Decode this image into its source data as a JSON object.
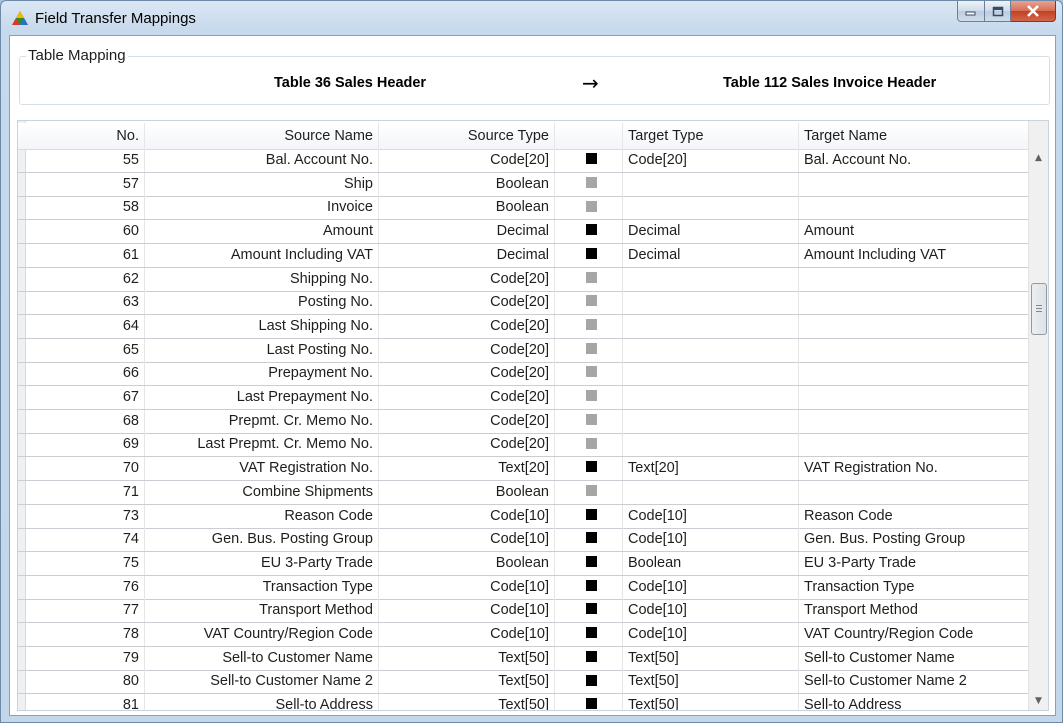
{
  "window": {
    "title": "Field Transfer Mappings",
    "buttons": {
      "minimize": "minimize",
      "maximize": "maximize",
      "close": "close"
    }
  },
  "mapping": {
    "group_label": "Table Mapping",
    "source_table": "Table 36 Sales Header",
    "arrow": "→",
    "target_table": "Table 112 Sales Invoice Header"
  },
  "grid": {
    "columns": {
      "no": "No.",
      "source_name": "Source Name",
      "source_type": "Source Type",
      "mapped": "",
      "target_type": "Target Type",
      "target_name": "Target Name"
    },
    "rows": [
      {
        "no": "55",
        "source_name": "Bal. Account No.",
        "source_type": "Code[20]",
        "mapped": true,
        "target_type": "Code[20]",
        "target_name": "Bal. Account No."
      },
      {
        "no": "57",
        "source_name": "Ship",
        "source_type": "Boolean",
        "mapped": false,
        "target_type": "",
        "target_name": ""
      },
      {
        "no": "58",
        "source_name": "Invoice",
        "source_type": "Boolean",
        "mapped": false,
        "target_type": "",
        "target_name": ""
      },
      {
        "no": "60",
        "source_name": "Amount",
        "source_type": "Decimal",
        "mapped": true,
        "target_type": "Decimal",
        "target_name": "Amount"
      },
      {
        "no": "61",
        "source_name": "Amount Including VAT",
        "source_type": "Decimal",
        "mapped": true,
        "target_type": "Decimal",
        "target_name": "Amount Including VAT"
      },
      {
        "no": "62",
        "source_name": "Shipping No.",
        "source_type": "Code[20]",
        "mapped": false,
        "target_type": "",
        "target_name": ""
      },
      {
        "no": "63",
        "source_name": "Posting No.",
        "source_type": "Code[20]",
        "mapped": false,
        "target_type": "",
        "target_name": ""
      },
      {
        "no": "64",
        "source_name": "Last Shipping No.",
        "source_type": "Code[20]",
        "mapped": false,
        "target_type": "",
        "target_name": ""
      },
      {
        "no": "65",
        "source_name": "Last Posting No.",
        "source_type": "Code[20]",
        "mapped": false,
        "target_type": "",
        "target_name": ""
      },
      {
        "no": "66",
        "source_name": "Prepayment No.",
        "source_type": "Code[20]",
        "mapped": false,
        "target_type": "",
        "target_name": ""
      },
      {
        "no": "67",
        "source_name": "Last Prepayment No.",
        "source_type": "Code[20]",
        "mapped": false,
        "target_type": "",
        "target_name": ""
      },
      {
        "no": "68",
        "source_name": "Prepmt. Cr. Memo No.",
        "source_type": "Code[20]",
        "mapped": false,
        "target_type": "",
        "target_name": ""
      },
      {
        "no": "69",
        "source_name": "Last Prepmt. Cr. Memo No.",
        "source_type": "Code[20]",
        "mapped": false,
        "target_type": "",
        "target_name": ""
      },
      {
        "no": "70",
        "source_name": "VAT Registration No.",
        "source_type": "Text[20]",
        "mapped": true,
        "target_type": "Text[20]",
        "target_name": "VAT Registration No."
      },
      {
        "no": "71",
        "source_name": "Combine Shipments",
        "source_type": "Boolean",
        "mapped": false,
        "target_type": "",
        "target_name": ""
      },
      {
        "no": "73",
        "source_name": "Reason Code",
        "source_type": "Code[10]",
        "mapped": true,
        "target_type": "Code[10]",
        "target_name": "Reason Code"
      },
      {
        "no": "74",
        "source_name": "Gen. Bus. Posting Group",
        "source_type": "Code[10]",
        "mapped": true,
        "target_type": "Code[10]",
        "target_name": "Gen. Bus. Posting Group"
      },
      {
        "no": "75",
        "source_name": "EU 3-Party Trade",
        "source_type": "Boolean",
        "mapped": true,
        "target_type": "Boolean",
        "target_name": "EU 3-Party Trade"
      },
      {
        "no": "76",
        "source_name": "Transaction Type",
        "source_type": "Code[10]",
        "mapped": true,
        "target_type": "Code[10]",
        "target_name": "Transaction Type"
      },
      {
        "no": "77",
        "source_name": "Transport Method",
        "source_type": "Code[10]",
        "mapped": true,
        "target_type": "Code[10]",
        "target_name": "Transport Method"
      },
      {
        "no": "78",
        "source_name": "VAT Country/Region Code",
        "source_type": "Code[10]",
        "mapped": true,
        "target_type": "Code[10]",
        "target_name": "VAT Country/Region Code"
      },
      {
        "no": "79",
        "source_name": "Sell-to Customer Name",
        "source_type": "Text[50]",
        "mapped": true,
        "target_type": "Text[50]",
        "target_name": "Sell-to Customer Name"
      },
      {
        "no": "80",
        "source_name": "Sell-to Customer Name 2",
        "source_type": "Text[50]",
        "mapped": true,
        "target_type": "Text[50]",
        "target_name": "Sell-to Customer Name 2"
      },
      {
        "no": "81",
        "source_name": "Sell-to Address",
        "source_type": "Text[50]",
        "mapped": true,
        "target_type": "Text[50]",
        "target_name": "Sell-to Address"
      }
    ]
  }
}
